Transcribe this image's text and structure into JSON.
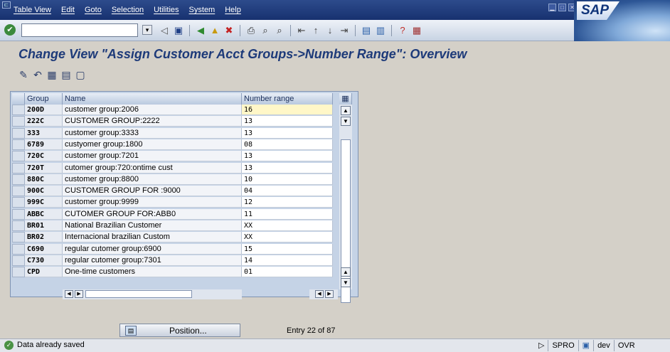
{
  "menu": {
    "items": [
      "Table View",
      "Edit",
      "Goto",
      "Selection",
      "Utilities",
      "System",
      "Help"
    ],
    "brand": "SAP"
  },
  "toolbar": {
    "ok_icon": "✔",
    "command_value": "",
    "icons": [
      "back-arrow",
      "save-icon",
      "back-green",
      "exit-yellow",
      "cancel-red",
      "print-icon",
      "find-icon",
      "find-next-icon",
      "first-page-icon",
      "prev-page-icon",
      "next-page-icon",
      "last-page-icon",
      "create-session-icon",
      "shortcut-icon",
      "help-icon",
      "customize-layout-icon"
    ]
  },
  "page_title": "Change View \"Assign Customer Acct Groups->Number Range\": Overview",
  "app_toolbar": {
    "icons": [
      "change-display-icon",
      "undo-icon",
      "select-all-icon",
      "select-block-icon",
      "deselect-all-icon"
    ]
  },
  "table": {
    "columns": [
      "Group",
      "Name",
      "Number range"
    ],
    "rows": [
      {
        "group": "200D",
        "name": "customer group:2006",
        "range": "16"
      },
      {
        "group": "222C",
        "name": "CUSTOMER GROUP:2222",
        "range": "13"
      },
      {
        "group": "333",
        "name": "customer group:3333",
        "range": "13"
      },
      {
        "group": "6789",
        "name": "custyomer group:1800",
        "range": "08"
      },
      {
        "group": "720C",
        "name": "customer group:7201",
        "range": "13"
      },
      {
        "group": "720T",
        "name": "cutomer group:720:ontime cust",
        "range": "13"
      },
      {
        "group": "880C",
        "name": "customer group:8800",
        "range": "10"
      },
      {
        "group": "900C",
        "name": "CUSTOMER GROUP FOR :9000",
        "range": "04"
      },
      {
        "group": "999C",
        "name": "customer group:9999",
        "range": "12"
      },
      {
        "group": "ABBC",
        "name": "CUTOMER GROUP FOR:ABB0",
        "range": "11"
      },
      {
        "group": "BR01",
        "name": "National  Brazilian Customer",
        "range": "XX"
      },
      {
        "group": "BR02",
        "name": "Internacional brazilian Custom",
        "range": "XX"
      },
      {
        "group": "C690",
        "name": "regular cutomer group:6900",
        "range": "15"
      },
      {
        "group": "C730",
        "name": "regular cutomer group:7301",
        "range": "14"
      },
      {
        "group": "CPD",
        "name": "One-time customers",
        "range": "01"
      }
    ]
  },
  "position_button": {
    "label": "Position..."
  },
  "entry_text": "Entry 22 of 87",
  "status": {
    "message": "Data already saved",
    "transaction": "SPRO",
    "system": "dev",
    "mode": "OVR"
  }
}
